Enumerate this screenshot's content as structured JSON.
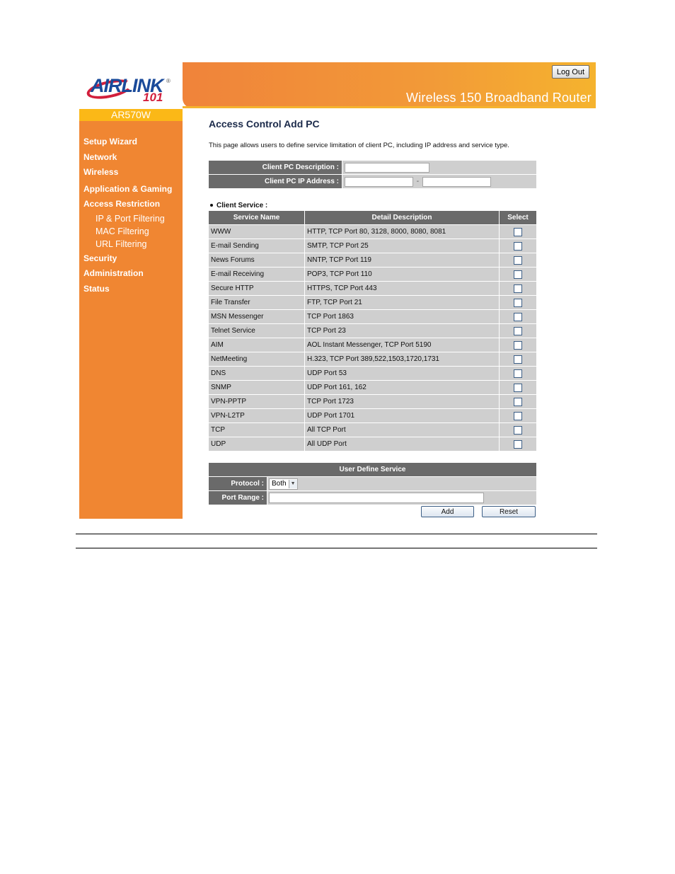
{
  "header": {
    "brand_name": "AIRLINK",
    "brand_number": "101",
    "registered_mark": "®",
    "model": "AR570W",
    "router_title": "Wireless 150 Broadband Router",
    "logout_label": "Log Out",
    "colors": {
      "banner_start": "#f0833a",
      "banner_end": "#f5b32e",
      "model_bar": "#fbb817",
      "sidebar": "#f08632"
    }
  },
  "sidebar": {
    "items": [
      {
        "label": "Setup Wizard",
        "level": 1
      },
      {
        "label": "Network",
        "level": 1
      },
      {
        "label": "Wireless",
        "level": 1
      },
      {
        "label": "Application & Gaming",
        "level": 1
      },
      {
        "label": "Access Restriction",
        "level": 1
      },
      {
        "label": "IP & Port Filtering",
        "level": 2
      },
      {
        "label": "MAC Filtering",
        "level": 2
      },
      {
        "label": "URL Filtering",
        "level": 2
      },
      {
        "label": "Security",
        "level": 1
      },
      {
        "label": "Administration",
        "level": 1
      },
      {
        "label": "Status",
        "level": 1
      }
    ]
  },
  "main": {
    "title": "Access Control Add PC",
    "description": "This page allows users to define service limitation of client PC, including IP address and service type.",
    "client": {
      "description_label": "Client PC Description :",
      "description_value": "",
      "ip_label": "Client PC IP Address :",
      "ip_start_value": "",
      "ip_separator": "-",
      "ip_end_value": ""
    },
    "client_service": {
      "label": "Client Service :",
      "columns": [
        "Service Name",
        "Detail Description",
        "Select"
      ],
      "rows": [
        {
          "name": "WWW",
          "detail": "HTTP, TCP Port 80, 3128, 8000, 8080, 8081",
          "selected": false
        },
        {
          "name": "E-mail Sending",
          "detail": "SMTP, TCP Port 25",
          "selected": false
        },
        {
          "name": "News Forums",
          "detail": "NNTP, TCP Port 119",
          "selected": false
        },
        {
          "name": "E-mail Receiving",
          "detail": "POP3, TCP Port 110",
          "selected": false
        },
        {
          "name": "Secure HTTP",
          "detail": "HTTPS, TCP Port 443",
          "selected": false
        },
        {
          "name": "File Transfer",
          "detail": "FTP, TCP Port 21",
          "selected": false
        },
        {
          "name": "MSN Messenger",
          "detail": "TCP Port 1863",
          "selected": false
        },
        {
          "name": "Telnet Service",
          "detail": "TCP Port 23",
          "selected": false
        },
        {
          "name": "AIM",
          "detail": "AOL Instant Messenger, TCP Port 5190",
          "selected": false
        },
        {
          "name": "NetMeeting",
          "detail": "H.323, TCP Port 389,522,1503,1720,1731",
          "selected": false
        },
        {
          "name": "DNS",
          "detail": "UDP Port 53",
          "selected": false
        },
        {
          "name": "SNMP",
          "detail": "UDP Port 161, 162",
          "selected": false
        },
        {
          "name": "VPN-PPTP",
          "detail": "TCP Port 1723",
          "selected": false
        },
        {
          "name": "VPN-L2TP",
          "detail": "UDP Port 1701",
          "selected": false
        },
        {
          "name": "TCP",
          "detail": "All TCP Port",
          "selected": false
        },
        {
          "name": "UDP",
          "detail": "All UDP Port",
          "selected": false
        }
      ]
    },
    "user_define": {
      "heading": "User Define Service",
      "protocol_label": "Protocol :",
      "protocol_value": "Both",
      "port_range_label": "Port Range :",
      "port_range_value": "",
      "add_label": "Add",
      "reset_label": "Reset"
    }
  }
}
